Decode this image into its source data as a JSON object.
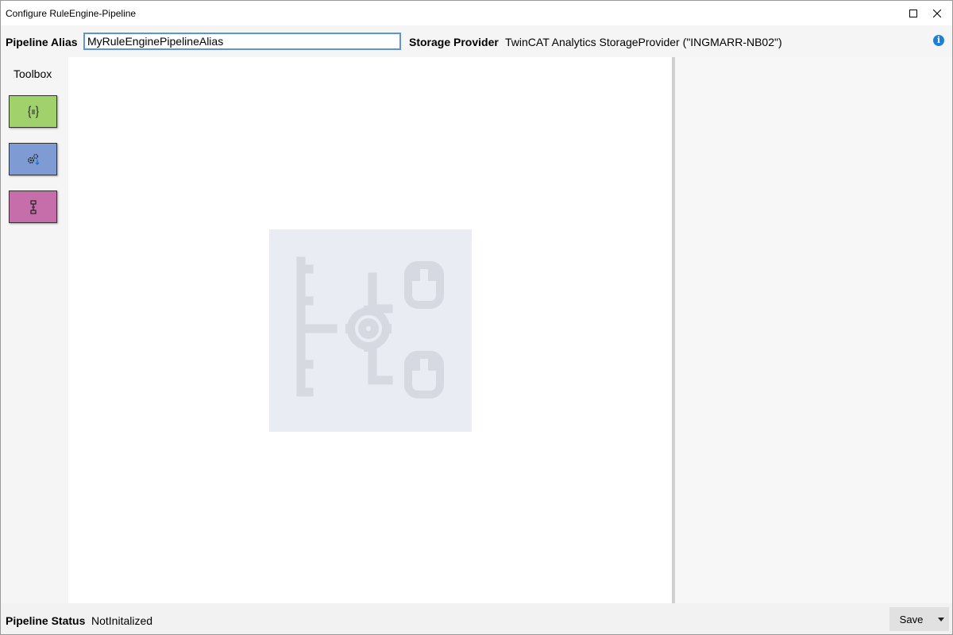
{
  "window": {
    "title": "Configure RuleEngine-Pipeline"
  },
  "header": {
    "alias_label": "Pipeline Alias",
    "alias_value": "MyRuleEnginePipelineAlias",
    "storage_label": "Storage Provider",
    "storage_value": "TwinCAT Analytics StorageProvider (\"INGMARR-NB02\")",
    "info_glyph": "i"
  },
  "toolbox": {
    "title": "Toolbox",
    "tools": [
      {
        "icon": "braces-icon",
        "color": "#a1d16b"
      },
      {
        "icon": "gears-icon",
        "color": "#7e9bd3"
      },
      {
        "icon": "connector-icon",
        "color": "#c56eaa"
      }
    ]
  },
  "canvas": {
    "watermark_icon": "pipeline-watermark-icon"
  },
  "statusbar": {
    "status_label": "Pipeline Status",
    "status_value": "NotInitalized",
    "save_label": "Save"
  },
  "colors": {
    "accent": "#5b95d8",
    "info": "#1e7fd8"
  }
}
